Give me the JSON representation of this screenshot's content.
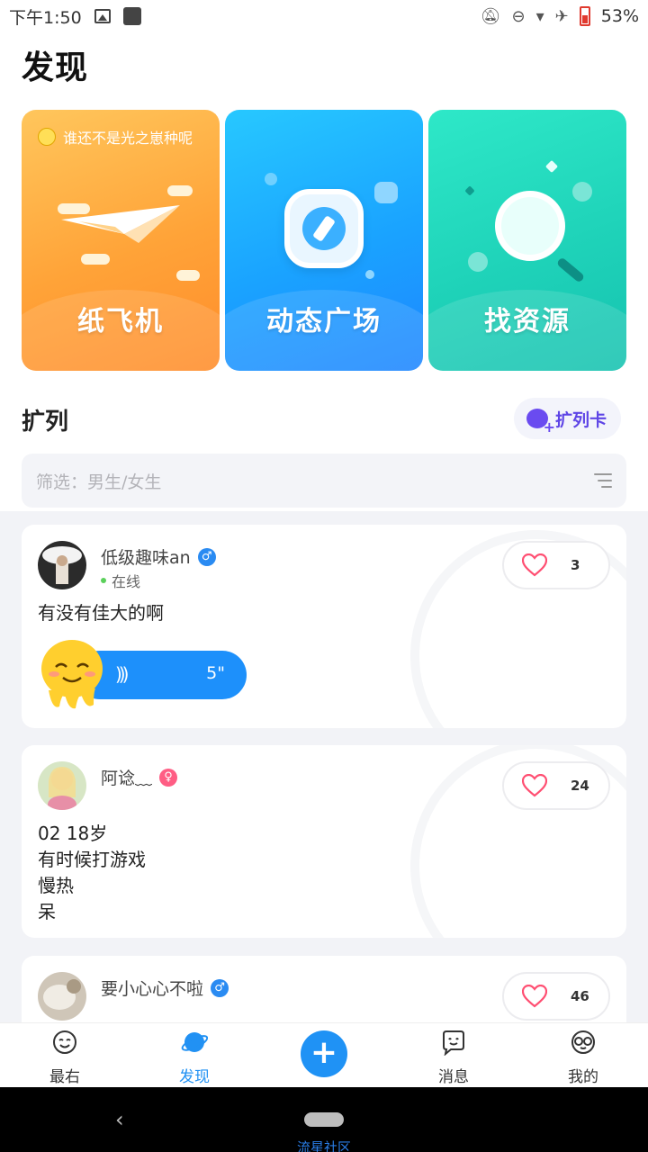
{
  "status_bar": {
    "time": "下午1:50",
    "battery": "53%",
    "battery_color": "#e03a2f"
  },
  "header": {
    "title": "发现"
  },
  "feature_cards": [
    {
      "label": "纸飞机",
      "tip": "谁还不是光之崽种呢",
      "icon": "paper-plane-icon",
      "color": "#ffa338"
    },
    {
      "label": "动态广场",
      "icon": "compass-icon",
      "color": "#1aa3ff"
    },
    {
      "label": "找资源",
      "icon": "magnifier-icon",
      "color": "#1fd3b9"
    }
  ],
  "section": {
    "title": "扩列",
    "card_button_label": "扩列卡",
    "filter_placeholder": "筛选：男生/女生"
  },
  "posts": [
    {
      "username": "低级趣味an",
      "gender": "male",
      "status": "在线",
      "likes": "3",
      "text": "有没有佳大的啊",
      "voice_duration": "5\""
    },
    {
      "username": "阿谂﹏",
      "gender": "female",
      "likes": "24",
      "lines": [
        "02  18岁",
        "有时候打游戏",
        "慢热",
        "呆"
      ]
    },
    {
      "username": "要小心心不啦",
      "gender": "male",
      "likes": "46"
    }
  ],
  "bottom_nav": {
    "items": [
      {
        "label": "最右",
        "icon": "smiley-icon"
      },
      {
        "label": "发现",
        "icon": "planet-icon",
        "active": true
      },
      {
        "label": "消息",
        "icon": "message-icon"
      },
      {
        "label": "我的",
        "icon": "glasses-face-icon"
      }
    ],
    "accent_color": "#2191f3"
  },
  "system_nav": {
    "caption": "流星社区"
  }
}
